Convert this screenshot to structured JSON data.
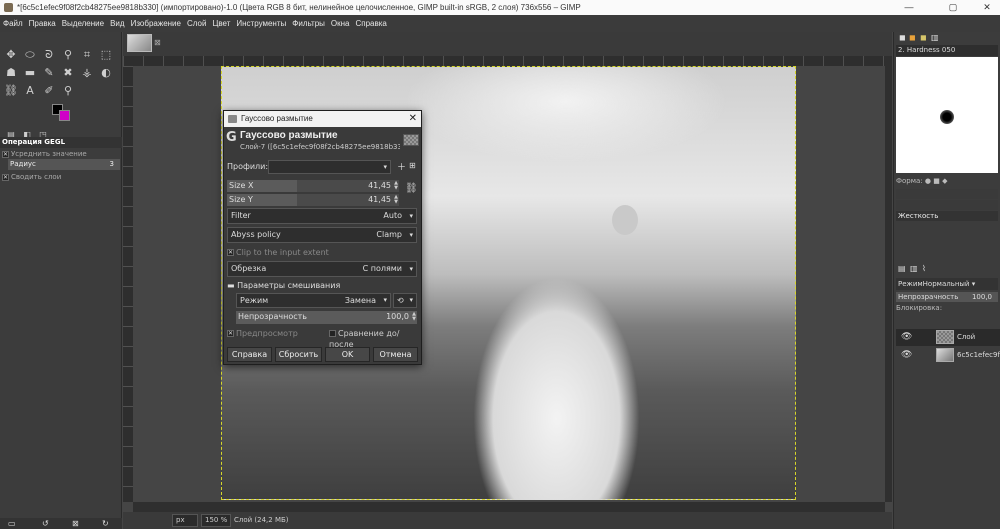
{
  "window": {
    "title": "*[6c5c1efec9f08f2cb48275ee9818b330] (импортировано)-1.0 (Цвета RGB 8 бит, нелинейное целочисленное, GIMP built-in sRGB, 2 слоя) 736x556 – GIMP",
    "minimize": "—",
    "maximize": "▢",
    "close": "✕"
  },
  "menu": [
    "Файл",
    "Правка",
    "Выделение",
    "Вид",
    "Изображение",
    "Слой",
    "Цвет",
    "Инструменты",
    "Фильтры",
    "Окна",
    "Справка"
  ],
  "tool_options": {
    "header": "Операция GEGL",
    "average": "Усреднить значение",
    "radius_label": "Радиус",
    "radius_value": "3",
    "merge": "Сводить слои"
  },
  "status": {
    "unit": "px",
    "zoom": "150 %",
    "layer_info": "Слой (24,2 МБ)"
  },
  "brushes": {
    "name": "2. Hardness 050",
    "shape_label": "Форма:",
    "hardness_label": "Жесткость"
  },
  "layers": {
    "mode_label": "Режим",
    "mode_value": "Нормальный",
    "opacity_label": "Непрозрачность",
    "opacity_value": "100,0",
    "lock_label": "Блокировка:",
    "items": [
      {
        "name": "Слой"
      },
      {
        "name": "6c5c1efec9f0"
      }
    ]
  },
  "dialog": {
    "window_title": "Гауссово размытие",
    "title": "Гауссово размытие",
    "subtitle": "Слой-7 ([6c5c1efec9f08f2cb48275ee9818b330...",
    "profiles_label": "Профили:",
    "size_x_label": "Size X",
    "size_x_value": "41,45",
    "size_y_label": "Size Y",
    "size_y_value": "41,45",
    "filter_label": "Filter",
    "filter_value": "Auto",
    "abyss_label": "Abyss policy",
    "abyss_value": "Clamp",
    "clip_label": "Clip to the input extent",
    "crop_label": "Обрезка",
    "crop_value": "С полями",
    "blend_header": "Параметры смешивания",
    "mode_label": "Режим",
    "mode_value": "Замена",
    "opacity_label": "Непрозрачность",
    "opacity_value": "100,0",
    "preview_label": "Предпросмотр",
    "compare_label": "Сравнение до/после",
    "btn_help": "Справка",
    "btn_reset": "Сбросить",
    "btn_ok": "OK",
    "btn_cancel": "Отмена"
  }
}
